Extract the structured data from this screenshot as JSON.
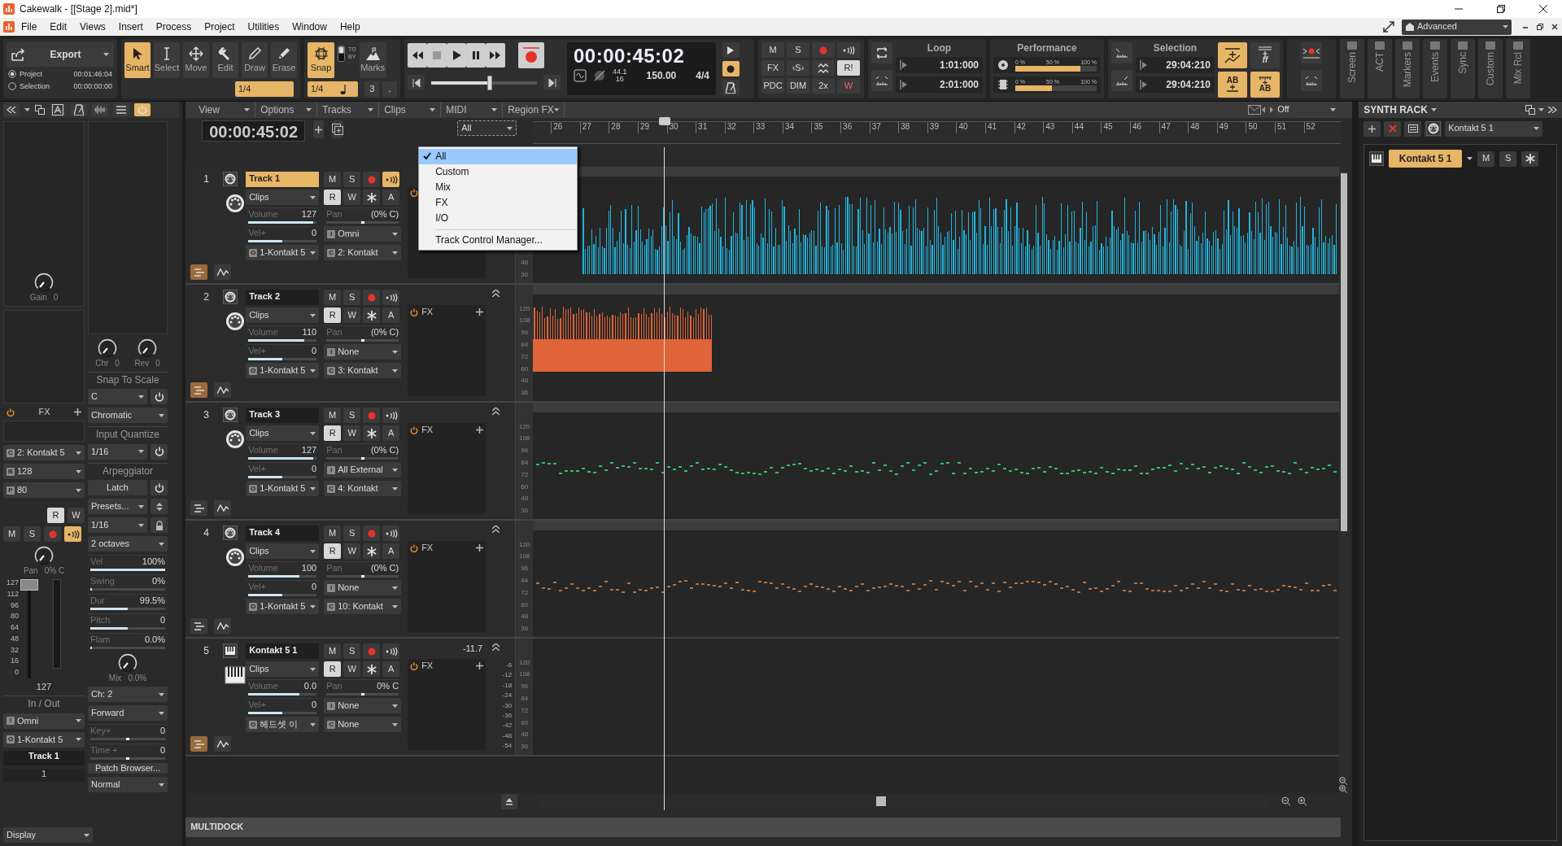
{
  "window": {
    "title": "Cakewalk - [[Stage 2].mid*]"
  },
  "menu": [
    "File",
    "Edit",
    "Views",
    "Insert",
    "Process",
    "Project",
    "Utilities",
    "Window",
    "Help"
  ],
  "workspace": "Advanced",
  "export": {
    "label": "Export",
    "ranges": [
      {
        "label": "Project",
        "time": "00:01:46:04",
        "selected": true
      },
      {
        "label": "Selection",
        "time": "00:00:00:00",
        "selected": false
      }
    ]
  },
  "tools": {
    "items": [
      {
        "label": "Smart",
        "kind": "smart",
        "selected": true
      },
      {
        "label": "Select",
        "kind": "select",
        "selected": false
      },
      {
        "label": "Move",
        "kind": "move",
        "selected": false
      },
      {
        "label": "Edit",
        "kind": "edit",
        "selected": false
      },
      {
        "label": "Draw",
        "kind": "draw",
        "selected": false
      },
      {
        "label": "Erase",
        "kind": "erase",
        "selected": false
      }
    ],
    "resolution": "1/4"
  },
  "snap": {
    "label": "Snap",
    "on": true,
    "by_mode": false,
    "to": "TO",
    "by": "BY",
    "value": "1/4",
    "triplet": "3",
    "dotted": ".",
    "marks": "Marks"
  },
  "transport": {
    "time": "00:00:45:02",
    "sample_rate": "44.1",
    "bit_depth": "16",
    "tempo": "150.00",
    "meter": "4/4",
    "level": 0.55
  },
  "mix": [
    {
      "kind": "text",
      "label": "M",
      "on": false
    },
    {
      "kind": "text",
      "label": "S",
      "on": false
    },
    {
      "kind": "record",
      "on": false
    },
    {
      "kind": "echo",
      "on": false
    },
    {
      "kind": "text",
      "label": "FX",
      "on": false
    },
    {
      "kind": "text",
      "label": "‹S›",
      "on": false
    },
    {
      "kind": "wave",
      "on": false
    },
    {
      "kind": "text",
      "label": "R!",
      "on": true
    },
    {
      "kind": "text",
      "label": "PDC",
      "on": false
    },
    {
      "kind": "text",
      "label": "DIM",
      "on": false
    },
    {
      "kind": "text",
      "label": "2x",
      "on": false
    },
    {
      "kind": "struck",
      "label": "W",
      "on": false
    }
  ],
  "loop": {
    "title": "Loop",
    "start": "1:01:000",
    "end": "2:01:000"
  },
  "performance": {
    "title": "Performance",
    "meters": [
      {
        "kind": "disk",
        "ticks": [
          "0 %",
          "50 %",
          "100 %"
        ],
        "level": 0.8
      },
      {
        "kind": "cpu",
        "ticks": [
          "0 %",
          "50 %",
          "100 %"
        ],
        "level": 0.45
      }
    ]
  },
  "selection": {
    "title": "Selection",
    "start": "29:04:210",
    "end": "29:04:210",
    "buttons": [
      {
        "kind": "automation",
        "on": true
      },
      {
        "kind": "dynamics",
        "label": "ff",
        "on": false
      },
      {
        "kind": "ab",
        "label": "AB",
        "on": true
      },
      {
        "kind": "ab-ruler",
        "label": "AB",
        "on": true
      }
    ]
  },
  "docks": [
    "Screen",
    "ACT",
    "Markers",
    "Events",
    "Sync",
    "Custom",
    "Mix Rcl"
  ],
  "inspector": {
    "gain": {
      "label": "Gain",
      "value": "0"
    },
    "chorus": {
      "label": "Chr",
      "value": "0"
    },
    "reverb": {
      "label": "Rev",
      "value": "0"
    },
    "fx": "FX",
    "routing": [
      {
        "badge": "C",
        "value": "2: Kontakt 5"
      },
      {
        "badge": "B",
        "value": "128"
      },
      {
        "badge": "P",
        "value": "80"
      }
    ],
    "read": "R",
    "write": "W",
    "mute": "M",
    "solo": "S",
    "echo": true,
    "pan": {
      "label": "Pan",
      "value": "0% C"
    },
    "fader": {
      "scale": [
        "127",
        "112",
        "96",
        "80",
        "64",
        "48",
        "32",
        "16",
        "0"
      ],
      "value": "127",
      "level": 1.0
    },
    "in_out": {
      "title": "In / Out",
      "input": {
        "badge": "I",
        "value": "Omni"
      },
      "output": {
        "badge": "O",
        "value": "1-Kontakt 5"
      }
    },
    "track_name": "Track 1",
    "track_number": "1",
    "snap_to_scale": {
      "title": "Snap To Scale",
      "key": "C",
      "scale": "Chromatic"
    },
    "input_quantize": {
      "title": "Input Quantize",
      "value": "1/16"
    },
    "arpeggiator": {
      "title": "Arpeggiator",
      "latch": "Latch",
      "presets": "Presets...",
      "rate": "1/16",
      "range": "2 octaves",
      "sliders": [
        {
          "label": "Vel",
          "value": "100%",
          "level": 1.0
        },
        {
          "label": "Swing",
          "value": "0%",
          "level": 0
        },
        {
          "label": "Dur",
          "value": "99.5%",
          "level": 0.5
        },
        {
          "label": "Pitch",
          "value": "0",
          "level": 0.5
        },
        {
          "label": "Flam",
          "value": "0.0%",
          "level": 0
        }
      ],
      "mix": {
        "label": "Mix",
        "value": "0.0%"
      },
      "channel": "Ch: 2",
      "direction": "Forward"
    },
    "offsets": [
      {
        "label": "Key+",
        "value": "0",
        "level": 0.5
      },
      {
        "label": "Time +",
        "value": "0",
        "level": 0.5
      }
    ],
    "patch_browser": "Patch Browser...",
    "mode": "Normal",
    "display": "Display"
  },
  "track_view": {
    "menus": [
      "View",
      "Options",
      "Tracks",
      "Clips",
      "MIDI",
      "Region FX"
    ],
    "zoom_mode": "Off",
    "time": "00:00:45:02",
    "filter": "All",
    "filter_menu": [
      {
        "label": "All",
        "kind": "filter",
        "selected": true
      },
      {
        "label": "Custom",
        "kind": "filter",
        "selected": false
      },
      {
        "label": "Mix",
        "kind": "filter",
        "selected": false
      },
      {
        "label": "FX",
        "kind": "filter",
        "selected": false
      },
      {
        "label": "I/O",
        "kind": "filter",
        "selected": false
      },
      {
        "label": "Track Control Manager...",
        "kind": "command",
        "selected": false
      }
    ],
    "ruler": [
      "26",
      "27",
      "28",
      "29",
      "30",
      "31",
      "32",
      "33",
      "34",
      "35",
      "36",
      "37",
      "38",
      "39",
      "40",
      "41",
      "42",
      "43",
      "44",
      "45",
      "46",
      "47",
      "48",
      "49",
      "50",
      "51",
      "52"
    ]
  },
  "tracks": [
    {
      "number": "1",
      "name": "Track 1",
      "kind": "midi",
      "selected": true,
      "echo": true,
      "lanes": true,
      "lane_view": "Clips",
      "buttons": [
        "M",
        "S",
        "R",
        "W",
        "A"
      ],
      "volume": {
        "label": "Volume",
        "value": "127",
        "level": 0.95
      },
      "pan": {
        "label": "Pan",
        "value": "(0% C)",
        "level": 0.5
      },
      "velocity": {
        "label": "Vel+",
        "value": "0",
        "level": 0.5
      },
      "input": {
        "badge": "I",
        "value": "Omni"
      },
      "output": {
        "badge": "O",
        "value": "1-Kontakt 5"
      },
      "channel": {
        "badge": "C",
        "value": "2: Kontakt"
      },
      "scale": [
        "48",
        "36"
      ],
      "clip": {
        "kind": "dense",
        "color": "#22b4dc"
      }
    },
    {
      "number": "2",
      "name": "Track 2",
      "kind": "midi",
      "selected": false,
      "echo": false,
      "lanes": true,
      "lane_view": "Clips",
      "buttons": [
        "M",
        "S",
        "R",
        "W",
        "A"
      ],
      "volume": {
        "label": "Volume",
        "value": "110",
        "level": 0.82
      },
      "pan": {
        "label": "Pan",
        "value": "(0% C)",
        "level": 0.5
      },
      "velocity": {
        "label": "Vel+",
        "value": "0",
        "level": 0.5
      },
      "input": {
        "badge": "I",
        "value": "None"
      },
      "output": {
        "badge": "O",
        "value": "1-Kontakt 5"
      },
      "channel": {
        "badge": "C",
        "value": "3: Kontakt"
      },
      "fx": "FX",
      "scale": [
        "120",
        "108",
        "96",
        "84",
        "72",
        "60",
        "48",
        "36"
      ],
      "clip": {
        "kind": "block",
        "color": "#e0643a"
      }
    },
    {
      "number": "3",
      "name": "Track 3",
      "kind": "midi",
      "selected": false,
      "echo": false,
      "lanes": false,
      "lane_view": "Clips",
      "buttons": [
        "M",
        "S",
        "R",
        "W",
        "A"
      ],
      "volume": {
        "label": "Volume",
        "value": "127",
        "level": 0.95
      },
      "pan": {
        "label": "Pan",
        "value": "(0% C)",
        "level": 0.5
      },
      "velocity": {
        "label": "Vel+",
        "value": "0",
        "level": 0.5
      },
      "input": {
        "badge": "I",
        "value": "All External"
      },
      "output": {
        "badge": "O",
        "value": "1-Kontakt 5"
      },
      "channel": {
        "badge": "C",
        "value": "4: Kontakt"
      },
      "fx": "FX",
      "scale": [
        "120",
        "108",
        "96",
        "84",
        "72",
        "60",
        "48",
        "36"
      ],
      "clip": {
        "kind": "dots",
        "color": "#2fbf6a"
      }
    },
    {
      "number": "4",
      "name": "Track 4",
      "kind": "midi",
      "selected": false,
      "echo": false,
      "lanes": false,
      "lane_view": "Clips",
      "buttons": [
        "M",
        "S",
        "R",
        "W",
        "A"
      ],
      "volume": {
        "label": "Volume",
        "value": "100",
        "level": 0.75
      },
      "pan": {
        "label": "Pan",
        "value": "(0% C)",
        "level": 0.5
      },
      "velocity": {
        "label": "Vel+",
        "value": "0",
        "level": 0.5
      },
      "input": {
        "badge": "I",
        "value": "None"
      },
      "output": {
        "badge": "O",
        "value": "1-Kontakt 5"
      },
      "channel": {
        "badge": "C",
        "value": "10: Kontakt"
      },
      "fx": "FX",
      "scale": [
        "120",
        "108",
        "96",
        "84",
        "72",
        "60",
        "48",
        "36"
      ],
      "clip": {
        "kind": "dots",
        "color": "#b8703a"
      }
    },
    {
      "number": "5",
      "name": "Kontakt 5 1",
      "kind": "synth",
      "selected": false,
      "echo": false,
      "lanes": true,
      "lane_view": "Clips",
      "buttons": [
        "M",
        "S",
        "R",
        "W",
        "A"
      ],
      "volume": {
        "label": "Volume",
        "value": "0.0",
        "level": 0.75
      },
      "pan": {
        "label": "Pan",
        "value": "0% C",
        "level": 0.5
      },
      "velocity": {
        "label": "Vel+",
        "value": "0",
        "level": 0.5
      },
      "input": {
        "badge": "I",
        "value": "None"
      },
      "output": {
        "badge": "O",
        "value": "헤드셋 이"
      },
      "channel": {
        "badge": "C",
        "value": "None"
      },
      "fx": "FX",
      "peak": "-11.7",
      "db_scale": [
        "-6",
        "-12",
        "-18",
        "-24",
        "-30",
        "-36",
        "-42",
        "-48",
        "-54"
      ],
      "scale": [
        "120",
        "108",
        "96",
        "84",
        "72",
        "60",
        "48",
        "36"
      ]
    }
  ],
  "synth_rack": {
    "title": "SYNTH RACK",
    "selector": "Kontakt 5 1",
    "instruments": [
      {
        "name": "Kontakt 5 1",
        "selected": true,
        "mute": "M",
        "solo": "S"
      }
    ]
  },
  "multidock": "MULTIDOCK"
}
